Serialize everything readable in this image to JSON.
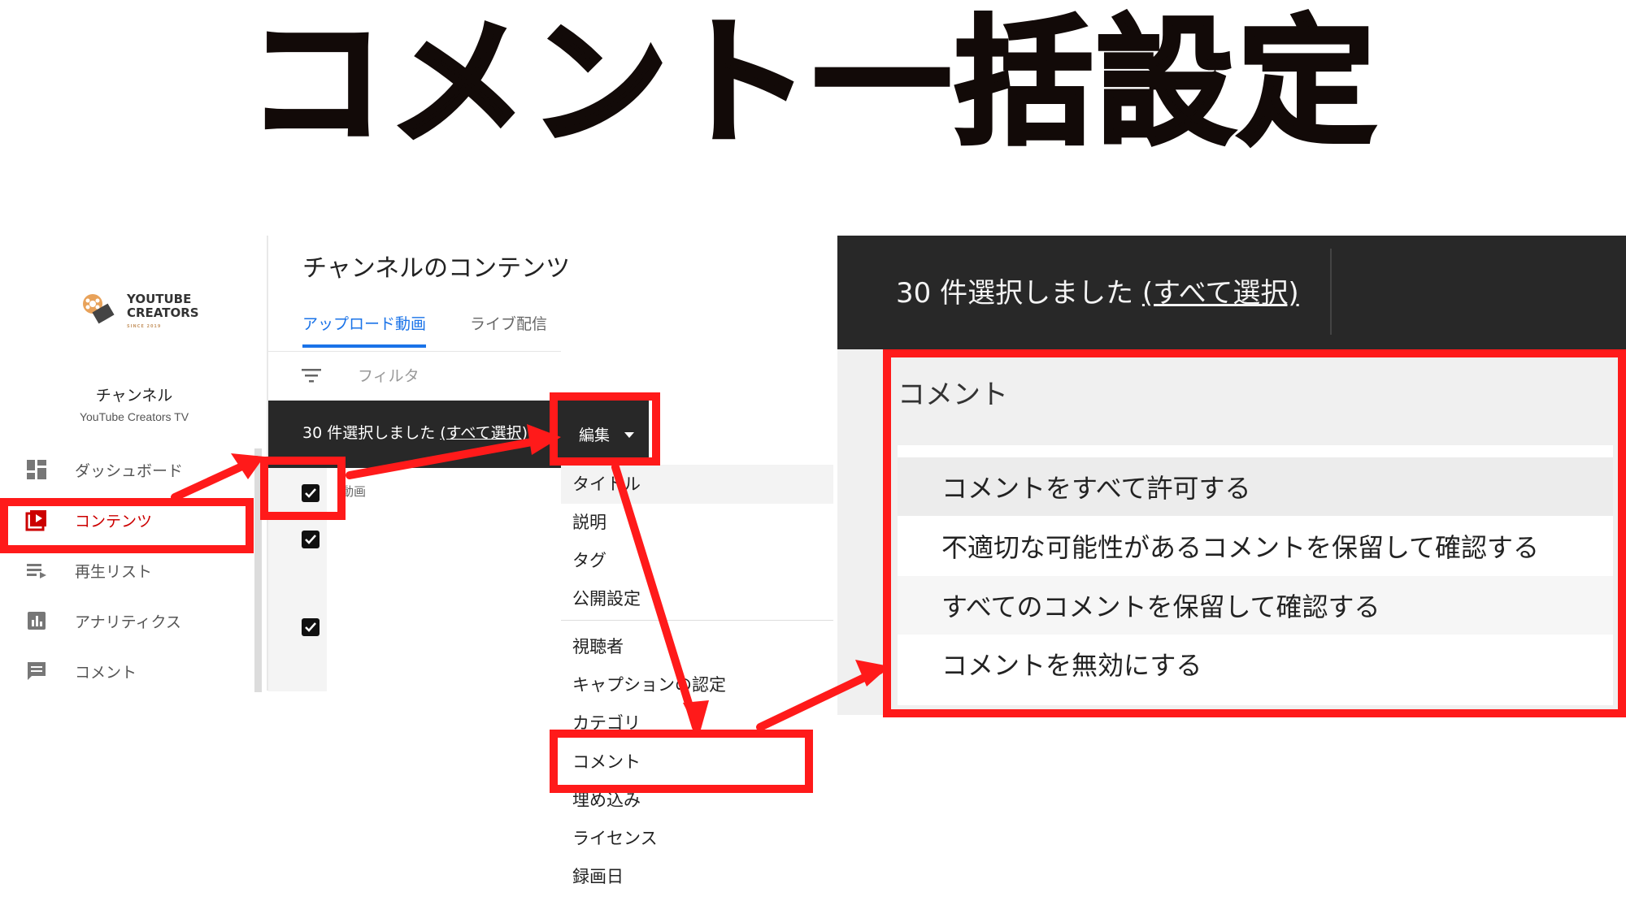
{
  "headline": "コメント一括設定",
  "colors": {
    "annotation_red": "#ff1a1a",
    "youtube_red": "#cc0000",
    "tab_blue": "#1a73e8",
    "dark_bar": "#282828"
  },
  "sidebar": {
    "logo": {
      "line1": "YOUTUBE",
      "line2": "CREATORS",
      "small": "SINCE 2019"
    },
    "channel_title": "チャンネル",
    "channel_name": "YouTube Creators TV",
    "items": [
      {
        "label": "ダッシュボード",
        "icon": "dashboard-icon"
      },
      {
        "label": "コンテンツ",
        "icon": "content-play-icon",
        "active": true
      },
      {
        "label": "再生リスト",
        "icon": "playlist-icon"
      },
      {
        "label": "アナリティクス",
        "icon": "analytics-icon"
      },
      {
        "label": "コメント",
        "icon": "comment-icon"
      }
    ]
  },
  "content": {
    "title": "チャンネルのコンテンツ",
    "tabs": [
      {
        "label": "アップロード動画",
        "active": true
      },
      {
        "label": "ライブ配信"
      }
    ],
    "filter_label": "フィルタ",
    "selection_text": "30 件選択しました",
    "select_all_text": "(すべて選択)",
    "edit_label": "編集",
    "video_column_label": "動画"
  },
  "edit_menu": {
    "items": [
      "タイトル",
      "説明",
      "タグ",
      "公開設定",
      "視聴者",
      "キャプションの認定",
      "カテゴリ",
      "コメント",
      "埋め込み",
      "ライセンス",
      "録画日"
    ]
  },
  "zoom_panel": {
    "selection_text": "30 件選択しました ",
    "select_all_text": "(すべて選択)",
    "comment_title": "コメント",
    "options": [
      "コメントをすべて許可する",
      "不適切な可能性があるコメントを保留して確認する",
      "すべてのコメントを保留して確認する",
      "コメントを無効にする"
    ]
  }
}
